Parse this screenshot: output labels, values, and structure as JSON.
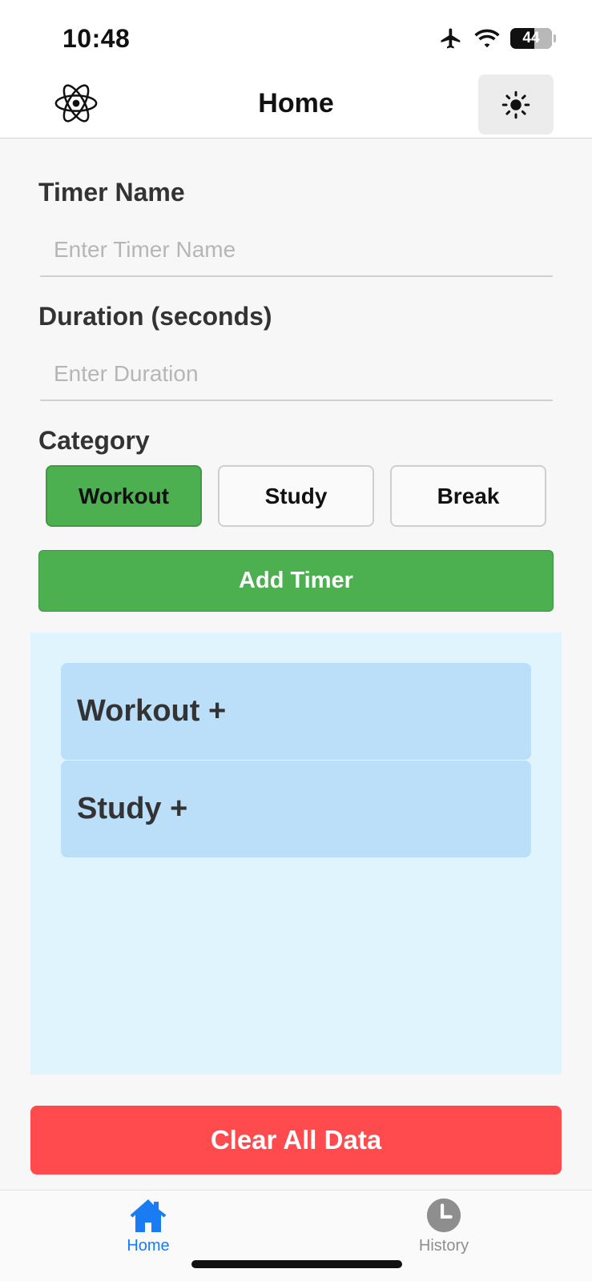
{
  "status_bar": {
    "time": "10:48",
    "battery": "44",
    "icons": [
      "airplane-icon",
      "wifi-icon",
      "battery-icon"
    ]
  },
  "header": {
    "title": "Home",
    "logo_icon": "react-atom-icon",
    "theme_icon": "sun-icon"
  },
  "form": {
    "timer_name_label": "Timer Name",
    "timer_name_placeholder": "Enter Timer Name",
    "timer_name_value": "",
    "duration_label": "Duration (seconds)",
    "duration_placeholder": "Enter Duration",
    "duration_value": "",
    "category_label": "Category",
    "categories": [
      {
        "label": "Workout",
        "selected": true
      },
      {
        "label": "Study",
        "selected": false
      },
      {
        "label": "Break",
        "selected": false
      }
    ],
    "add_button_label": "Add Timer"
  },
  "groups": [
    {
      "label": "Workout +"
    },
    {
      "label": "Study +"
    }
  ],
  "clear_button_label": "Clear All Data",
  "tabs": [
    {
      "label": "Home",
      "icon": "home-icon",
      "active": true
    },
    {
      "label": "History",
      "icon": "clock-icon",
      "active": false
    }
  ],
  "colors": {
    "accent_green": "#4caf50",
    "danger_red": "#ff4b4e",
    "panel_blue": "#e0f4fd",
    "group_blue": "#bbdef9",
    "tab_active": "#1a7cf3",
    "tab_inactive": "#8e8e8e"
  }
}
